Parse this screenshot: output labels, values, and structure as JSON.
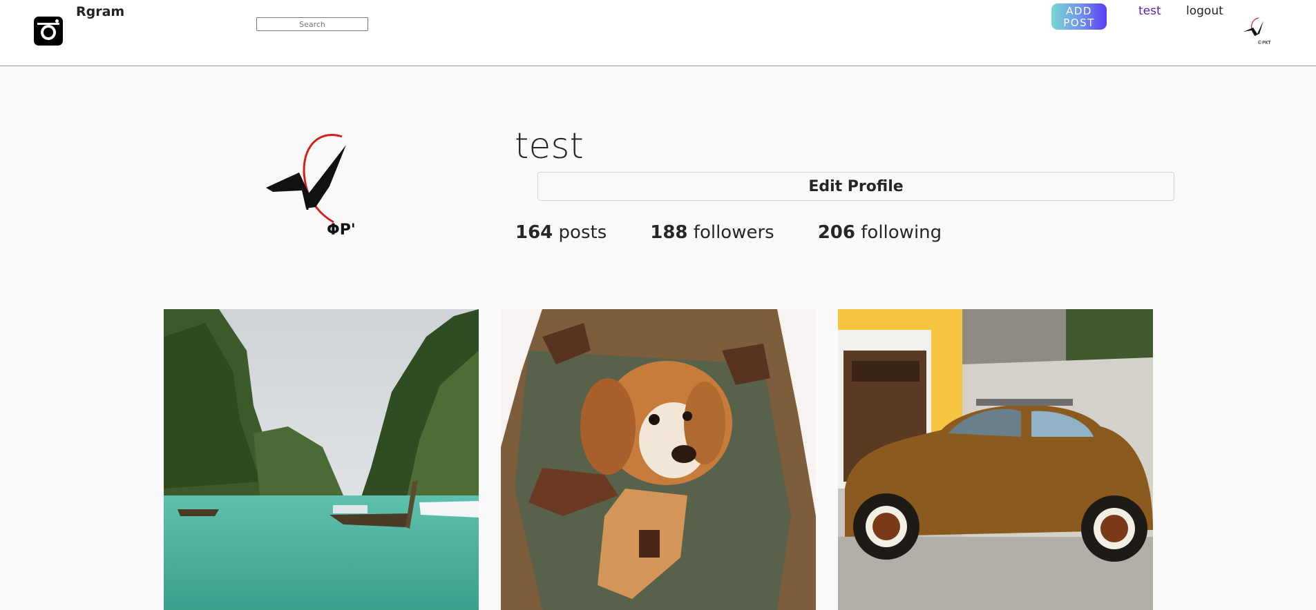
{
  "header": {
    "brand": "Rgram",
    "search_placeholder": "Search",
    "add_post_label": "ADD POST",
    "user_link": "test",
    "logout_link": "logout",
    "avatar_caption": "©PKT"
  },
  "profile": {
    "username": "test",
    "edit_button": "Edit Profile",
    "stats": [
      {
        "count": "164",
        "label": "posts"
      },
      {
        "count": "188",
        "label": "followers"
      },
      {
        "count": "206",
        "label": "following"
      }
    ]
  },
  "posts": [
    {
      "subject": "tropical-bay-longtail-boats"
    },
    {
      "subject": "puppy-in-backpack"
    },
    {
      "subject": "vintage-beetle-car"
    }
  ],
  "colors": {
    "user_link": "#5a1ca8",
    "add_post_gradient_start": "#7ad9d2",
    "add_post_gradient_end": "#5b3df2",
    "page_bg": "#fafafa"
  }
}
